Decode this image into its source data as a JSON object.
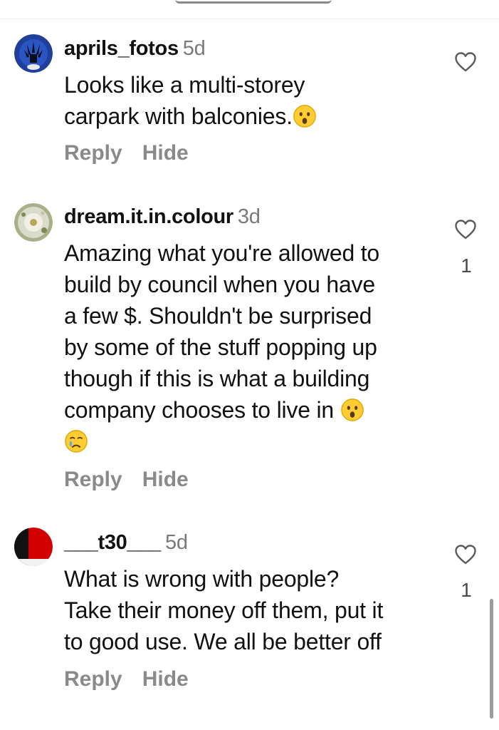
{
  "comments": [
    {
      "username": "aprils_fotos",
      "time": "5d",
      "lines": [
        "Looks like a multi-storey",
        "carpark with balconies."
      ],
      "emoji": "astonished-face",
      "reply_label": "Reply",
      "hide_label": "Hide",
      "likes": ""
    },
    {
      "username": "dream.it.in.colour",
      "time": "3d",
      "lines": [
        "Amazing what you're allowed to",
        "build by council when you have",
        "a few $. Shouldn't be surprised",
        "by some of the stuff popping up",
        "though if this is what a building",
        "company chooses to live in"
      ],
      "emoji_1": "astonished-face",
      "emoji_2": "crying-face",
      "reply_label": "Reply",
      "hide_label": "Hide",
      "likes": "1"
    },
    {
      "username": "___t30___",
      "time": "5d",
      "lines": [
        "What is wrong with people?",
        "Take their money off them, put it",
        "to good use. We all be better off"
      ],
      "reply_label": "Reply",
      "hide_label": "Hide",
      "likes": "1"
    }
  ],
  "colors": {
    "text": "#111111",
    "muted": "#7a7a7a",
    "action": "#8a8a8a"
  }
}
